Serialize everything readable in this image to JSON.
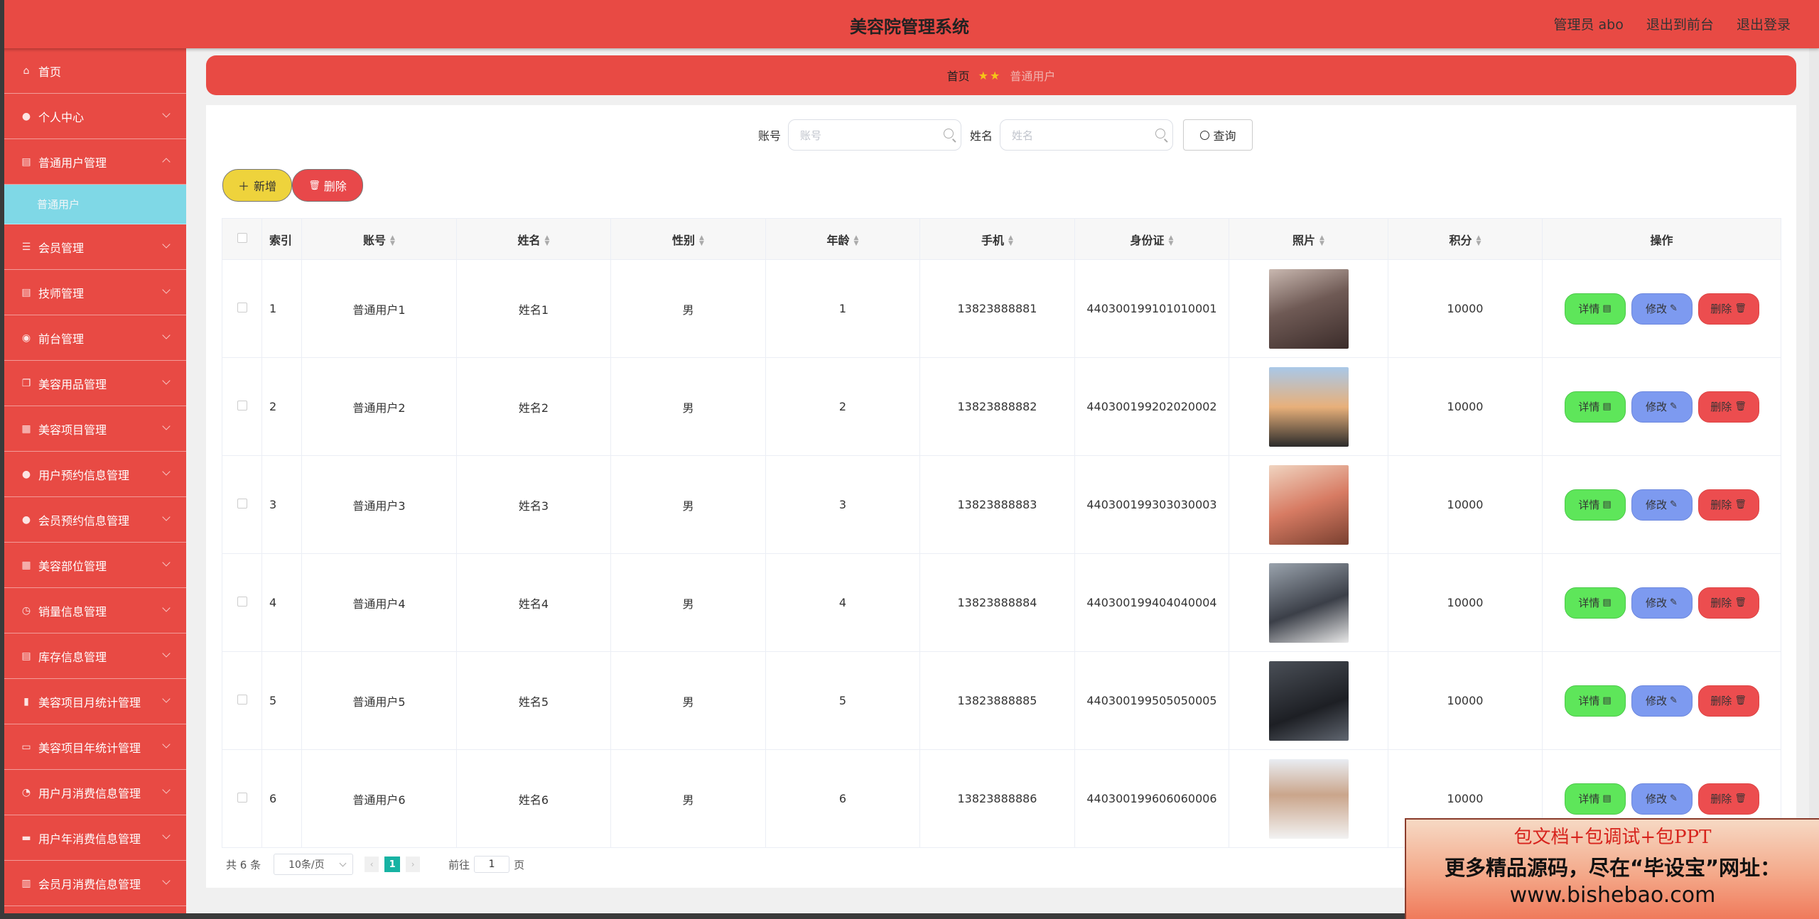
{
  "header": {
    "title": "美容院管理系统",
    "admin_label": "管理员 abo",
    "to_front": "退出到前台",
    "logout": "退出登录"
  },
  "sidebar": {
    "items": [
      {
        "label": "首页",
        "icon": "home-icon",
        "chevron": false
      },
      {
        "label": "个人中心",
        "icon": "user-icon",
        "chevron": true
      },
      {
        "label": "普通用户管理",
        "icon": "clipboard-icon",
        "chevron": true,
        "expanded": true
      },
      {
        "label": "会员管理",
        "icon": "list-icon",
        "chevron": true
      },
      {
        "label": "技师管理",
        "icon": "clipboard-icon",
        "chevron": true
      },
      {
        "label": "前台管理",
        "icon": "location-icon",
        "chevron": true
      },
      {
        "label": "美容用品管理",
        "icon": "copy-icon",
        "chevron": true
      },
      {
        "label": "美容项目管理",
        "icon": "grid-icon",
        "chevron": true
      },
      {
        "label": "用户预约信息管理",
        "icon": "user-icon",
        "chevron": true
      },
      {
        "label": "会员预约信息管理",
        "icon": "user-icon",
        "chevron": true
      },
      {
        "label": "美容部位管理",
        "icon": "grid-icon",
        "chevron": true
      },
      {
        "label": "销量信息管理",
        "icon": "timer-icon",
        "chevron": true
      },
      {
        "label": "库存信息管理",
        "icon": "clipboard-icon",
        "chevron": true
      },
      {
        "label": "美容项目月统计管理",
        "icon": "chart-icon",
        "chevron": true
      },
      {
        "label": "美容项目年统计管理",
        "icon": "monitor-icon",
        "chevron": true
      },
      {
        "label": "用户月消费信息管理",
        "icon": "clock-icon",
        "chevron": true
      },
      {
        "label": "用户年消费信息管理",
        "icon": "ticket-icon",
        "chevron": true
      },
      {
        "label": "会员月消费信息管理",
        "icon": "bar-chart-icon",
        "chevron": true
      }
    ],
    "submenu_active": "普通用户"
  },
  "breadcrumb": {
    "home": "首页",
    "current": "普通用户"
  },
  "search": {
    "account_label": "账号",
    "account_placeholder": "账号",
    "name_label": "姓名",
    "name_placeholder": "姓名",
    "query_button": "查询"
  },
  "actions": {
    "add": "新增",
    "delete": "删除"
  },
  "table": {
    "headers": [
      "索引",
      "账号",
      "姓名",
      "性别",
      "年龄",
      "手机",
      "身份证",
      "照片",
      "积分",
      "操作"
    ],
    "rows": [
      {
        "index": "1",
        "account": "普通用户1",
        "name": "姓名1",
        "gender": "男",
        "age": "1",
        "phone": "13823888881",
        "idcard": "440300199101010001",
        "points": "10000",
        "photo": "photo-1"
      },
      {
        "index": "2",
        "account": "普通用户2",
        "name": "姓名2",
        "gender": "男",
        "age": "2",
        "phone": "13823888882",
        "idcard": "440300199202020002",
        "points": "10000",
        "photo": "photo-2"
      },
      {
        "index": "3",
        "account": "普通用户3",
        "name": "姓名3",
        "gender": "男",
        "age": "3",
        "phone": "13823888883",
        "idcard": "440300199303030003",
        "points": "10000",
        "photo": "photo-3"
      },
      {
        "index": "4",
        "account": "普通用户4",
        "name": "姓名4",
        "gender": "男",
        "age": "4",
        "phone": "13823888884",
        "idcard": "440300199404040004",
        "points": "10000",
        "photo": "photo-4"
      },
      {
        "index": "5",
        "account": "普通用户5",
        "name": "姓名5",
        "gender": "男",
        "age": "5",
        "phone": "13823888885",
        "idcard": "440300199505050005",
        "points": "10000",
        "photo": "photo-5"
      },
      {
        "index": "6",
        "account": "普通用户6",
        "name": "姓名6",
        "gender": "男",
        "age": "6",
        "phone": "13823888886",
        "idcard": "440300199606060006",
        "points": "10000",
        "photo": "photo-6"
      }
    ],
    "row_buttons": {
      "detail": "详情",
      "edit": "修改",
      "delete": "删除"
    }
  },
  "pagination": {
    "total_text": "共 6 条",
    "page_size": "10条/页",
    "current_page": "1",
    "goto_label": "前往",
    "goto_value": "1",
    "page_suffix": "页"
  },
  "promo": {
    "line1": "包文档+包调试+包PPT",
    "line2": "更多精品源码，尽在“毕设宝”网址：",
    "line3": "www.bishebao.com"
  },
  "colors": {
    "primary_red": "#e84a44",
    "submenu_cyan": "#7fd8e6",
    "add_yellow": "#eed33c",
    "detail_green": "#5ee65a",
    "edit_blue": "#7d9af0",
    "delete_red": "#ec4d4f",
    "page_active": "#17b3a3"
  }
}
